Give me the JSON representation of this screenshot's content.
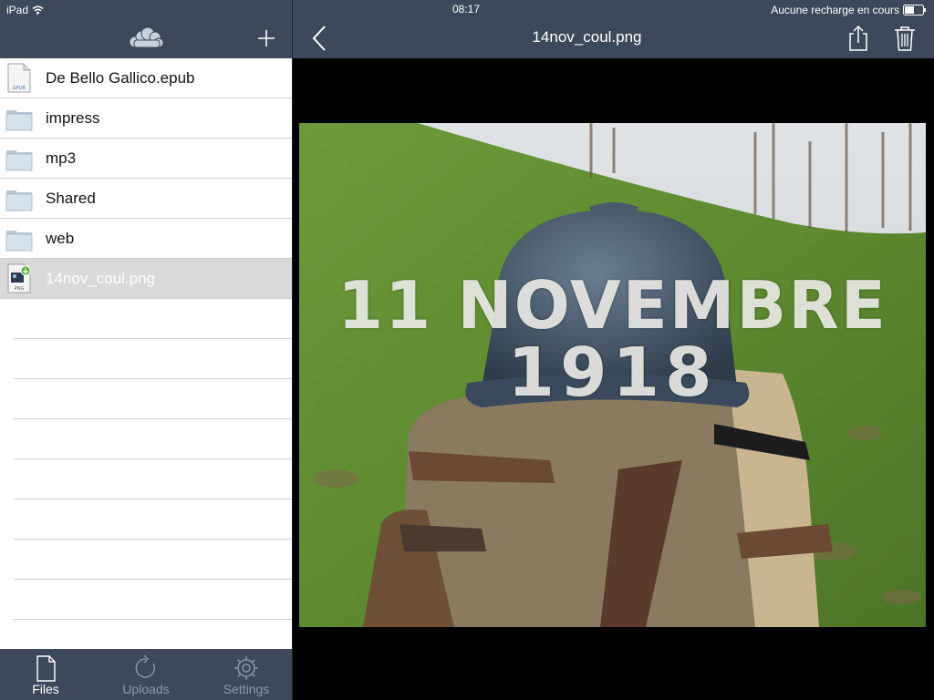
{
  "status_bar": {
    "device": "iPad",
    "time": "08:17",
    "charging": "Aucune recharge en cours"
  },
  "file_list": {
    "items": [
      {
        "name": "De Bello Gallico.epub",
        "icon": "epub-file-icon",
        "icon_label": "EPUB"
      },
      {
        "name": "impress",
        "icon": "folder-icon"
      },
      {
        "name": "mp3",
        "icon": "folder-icon"
      },
      {
        "name": "Shared",
        "icon": "folder-icon"
      },
      {
        "name": "web",
        "icon": "folder-icon"
      },
      {
        "name": "14nov_coul.png",
        "icon": "png-file-icon",
        "icon_label": "PNG",
        "selected": true
      }
    ]
  },
  "tab_bar": {
    "files": "Files",
    "uploads": "Uploads",
    "settings": "Settings",
    "active": "files"
  },
  "preview": {
    "title": "14nov_coul.png",
    "image_caption_line1": "11 NOVEMBRE",
    "image_caption_line2": "1918"
  },
  "colors": {
    "nav_bar": "#3d495b",
    "tab_active": "#ffffff",
    "tab_inactive": "#8d96a4",
    "selected_row": "#d9d9d9"
  }
}
